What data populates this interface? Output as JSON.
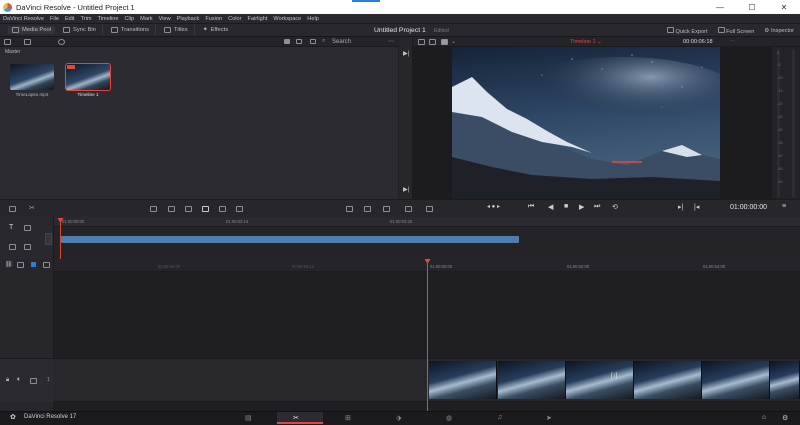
{
  "window": {
    "title": "DaVinci Resolve - Untitled Project 1",
    "controls": [
      "—",
      "☐",
      "✕"
    ]
  },
  "menu": [
    "DaVinci Resolve",
    "File",
    "Edit",
    "Trim",
    "Timeline",
    "Clip",
    "Mark",
    "View",
    "Playback",
    "Fusion",
    "Color",
    "Fairlight",
    "Workspace",
    "Help"
  ],
  "toolbar": {
    "media_pool": "Media Pool",
    "sync_bin": "Sync Bin",
    "transitions": "Transitions",
    "titles": "Titles",
    "effects": "Effects",
    "project_name": "Untitled Project 1",
    "status": "Edited",
    "quick_export": "Quick Export",
    "full_screen": "Full Screen",
    "inspector": "Inspector"
  },
  "media_pool": {
    "search_label": "Search",
    "bin": "Master",
    "clips": [
      {
        "name": "TimeLapse.mp4",
        "selected": false
      },
      {
        "name": "Timeline 1",
        "selected": true
      }
    ]
  },
  "viewer": {
    "timeline_name": "Timeline 1 ⌄",
    "timecode_top": "00:00:06:18",
    "timecode": "01:00:00:00"
  },
  "meters": [
    "0",
    "-5",
    "-10",
    "-15",
    "-20",
    "-25",
    "-30",
    "-35",
    "-40",
    "-45",
    "-50"
  ],
  "upper_timeline": {
    "ruler": [
      "01:00:00:00",
      "01:00:02:14",
      "01:00:04:28"
    ]
  },
  "lower_timeline": {
    "ruler": [
      "00:59:59:00",
      "00:59:59:12",
      "01:00:00:00",
      "01:00:02:00",
      "01:00:04:00"
    ],
    "track_number": "1"
  },
  "bottom": {
    "app_version": "DaVinci Resolve 17",
    "pages": [
      "media-page-icon",
      "cut-page-icon",
      "edit-page-icon",
      "fusion-page-icon",
      "color-page-icon",
      "fairlight-page-icon",
      "deliver-page-icon"
    ]
  },
  "colors": {
    "accent": "#e2473c",
    "clip_blue": "#4e7eab",
    "panel": "#28282e",
    "background": "#1f1f24"
  }
}
